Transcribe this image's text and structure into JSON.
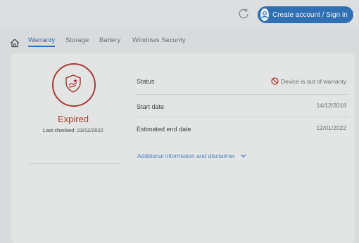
{
  "header": {
    "signin_label": "Create account / Sign in"
  },
  "tabs": [
    {
      "label": "Warranty",
      "active": true
    },
    {
      "label": "Storage",
      "active": false
    },
    {
      "label": "Battery",
      "active": false
    },
    {
      "label": "Windows Security",
      "active": false
    }
  ],
  "summary": {
    "status_title": "Expired",
    "last_checked": "Last checked: 23/12/2022"
  },
  "details": [
    {
      "label": "Status",
      "value": "Device is out of warranty"
    },
    {
      "label": "Start date",
      "value": "14/12/2018"
    },
    {
      "label": "Estimated end date",
      "value": "12/01/2022"
    }
  ],
  "disclaimer_label": "Additional information and disclaimer",
  "colors": {
    "accent": "#2f6fb3",
    "expired": "#b03a30"
  },
  "icons": [
    "refresh-icon",
    "user-icon",
    "chevron-down-icon",
    "home-icon",
    "shield-hand-icon",
    "no-entry-icon"
  ]
}
